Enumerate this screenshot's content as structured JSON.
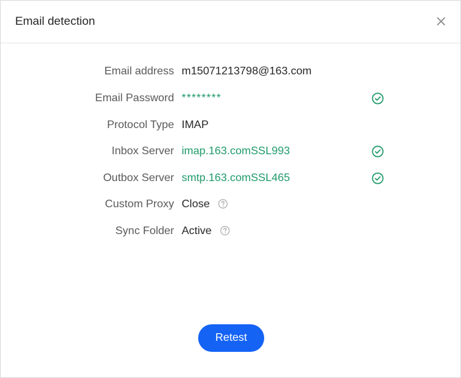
{
  "dialog": {
    "title": "Email detection",
    "close_icon": "close-icon"
  },
  "fields": {
    "email": {
      "label": "Email address",
      "value": "m15071213798@163.com"
    },
    "password": {
      "label": "Email Password",
      "value": "********",
      "status": "success",
      "status_icon": "check-circle-icon"
    },
    "protocol": {
      "label": "Protocol Type",
      "value": "IMAP"
    },
    "inbox": {
      "label": "Inbox Server",
      "value": "imap.163.comSSL993",
      "status": "success",
      "status_icon": "check-circle-icon"
    },
    "outbox": {
      "label": "Outbox Server",
      "value": "smtp.163.comSSL465",
      "status": "success",
      "status_icon": "check-circle-icon"
    },
    "proxy": {
      "label": "Custom Proxy",
      "value": "Close",
      "help_icon": "question-circle-icon"
    },
    "sync": {
      "label": "Sync Folder",
      "value": "Active",
      "help_icon": "question-circle-icon"
    }
  },
  "actions": {
    "retest_label": "Retest"
  },
  "colors": {
    "accent": "#1463f5",
    "success": "#1f9a6a",
    "label": "#595959",
    "text": "#262626"
  }
}
